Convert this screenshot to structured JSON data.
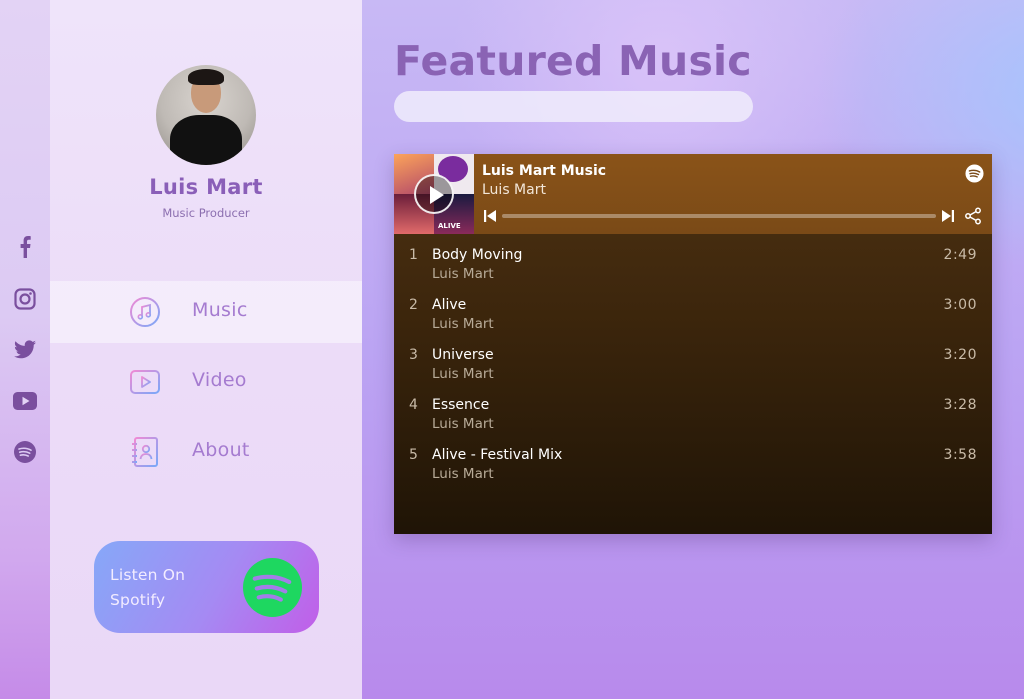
{
  "profile": {
    "name": "Luis Mart",
    "role": "Music Producer"
  },
  "social": {
    "items": [
      "facebook-icon",
      "instagram-icon",
      "twitter-icon",
      "youtube-icon",
      "spotify-icon"
    ]
  },
  "nav": {
    "items": [
      {
        "label": "Music",
        "icon": "music-icon",
        "active": true
      },
      {
        "label": "Video",
        "icon": "video-icon",
        "active": false
      },
      {
        "label": "About",
        "icon": "contact-book-icon",
        "active": false
      }
    ]
  },
  "spotify_cta": {
    "line1": "Listen On",
    "line2": "Spotify"
  },
  "main": {
    "title": "Featured Music"
  },
  "player": {
    "title": "Luis Mart Music",
    "artist": "Luis Mart",
    "cover_text": "ALIVE",
    "tracks": [
      {
        "num": "1",
        "name": "Body Moving",
        "artist": "Luis Mart",
        "duration": "2:49"
      },
      {
        "num": "2",
        "name": "Alive",
        "artist": "Luis Mart",
        "duration": "3:00"
      },
      {
        "num": "3",
        "name": "Universe",
        "artist": "Luis Mart",
        "duration": "3:20"
      },
      {
        "num": "4",
        "name": "Essence",
        "artist": "Luis Mart",
        "duration": "3:28"
      },
      {
        "num": "5",
        "name": "Alive - Festival Mix",
        "artist": "Luis Mart",
        "duration": "3:58"
      }
    ]
  },
  "colors": {
    "accent": "#8a5fb8",
    "spotify_green": "#1ed760",
    "player_header": "#7a4a17"
  }
}
